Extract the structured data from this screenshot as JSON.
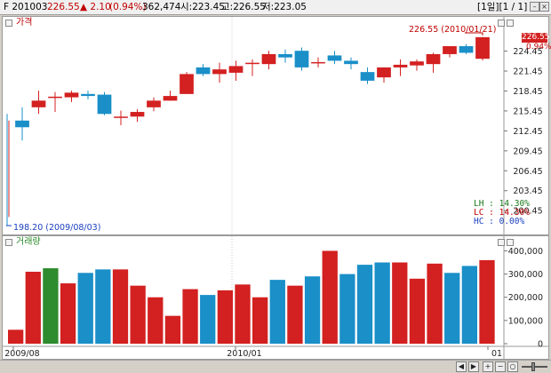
{
  "header": {
    "code": "F 201003",
    "price": "226.55",
    "change": "▲ 2.10",
    "change_pct": "(0.94%)",
    "volume": "362,474",
    "open": "시:223.45",
    "high": "고:226.55",
    "low": "저:223.05",
    "nav": "[1일][1 / 1]"
  },
  "price_pane": {
    "title": "가격",
    "last_price_label": "226.55",
    "last_change_label": "0.94%",
    "high_annotation": "226.55 (2010/01/21)",
    "low_annotation": "198.20 (2009/08/03)",
    "stats": {
      "lh": "LH : 14.30%",
      "lc": "LC : 14.30%",
      "hc": "HC :  0.00%"
    }
  },
  "volume_pane": {
    "title": "거래량"
  },
  "colors": {
    "up": "#d32020",
    "down": "#1a8fc8",
    "volume_green": "#2e8b2e",
    "pane_title_price": "#c00000",
    "pane_title_volume": "#2e8b2e",
    "stat_lh": "#1a7a1a",
    "stat_lc": "#c00000",
    "stat_hc": "#1a3fc0"
  },
  "chart_data": [
    {
      "type": "candlestick",
      "title": "가격",
      "ylim": [
        197,
        228
      ],
      "yticks": [
        200.45,
        203.45,
        206.45,
        209.45,
        212.45,
        215.45,
        218.45,
        221.45,
        224.45
      ],
      "xticks": [
        "2009/08",
        "2010/01",
        "01"
      ],
      "candles": [
        {
          "open": 214.0,
          "high": 216.0,
          "low": 211.0,
          "close": 213.0
        },
        {
          "open": 216.0,
          "high": 218.5,
          "low": 215.0,
          "close": 217.0
        },
        {
          "open": 217.6,
          "high": 218.3,
          "low": 215.3,
          "close": 217.6
        },
        {
          "open": 217.5,
          "high": 218.5,
          "low": 216.8,
          "close": 218.2
        },
        {
          "open": 218.0,
          "high": 218.5,
          "low": 217.2,
          "close": 217.7
        },
        {
          "open": 217.9,
          "high": 218.3,
          "low": 214.8,
          "close": 215.0
        },
        {
          "open": 214.6,
          "high": 215.5,
          "low": 213.3,
          "close": 214.6
        },
        {
          "open": 214.6,
          "high": 215.7,
          "low": 213.8,
          "close": 215.3
        },
        {
          "open": 216.0,
          "high": 217.5,
          "low": 215.4,
          "close": 217.0
        },
        {
          "open": 217.0,
          "high": 218.5,
          "low": 217.0,
          "close": 217.7
        },
        {
          "open": 218.0,
          "high": 221.3,
          "low": 218.0,
          "close": 221.0
        },
        {
          "open": 222.0,
          "high": 222.5,
          "low": 220.7,
          "close": 221.0
        },
        {
          "open": 221.0,
          "high": 222.7,
          "low": 219.7,
          "close": 221.7
        },
        {
          "open": 221.2,
          "high": 223.0,
          "low": 220.0,
          "close": 222.2
        },
        {
          "open": 222.7,
          "high": 223.2,
          "low": 220.7,
          "close": 222.7
        },
        {
          "open": 222.5,
          "high": 224.5,
          "low": 221.7,
          "close": 224.0
        },
        {
          "open": 224.0,
          "high": 224.7,
          "low": 222.7,
          "close": 223.5
        },
        {
          "open": 224.5,
          "high": 225.0,
          "low": 221.5,
          "close": 222.0
        },
        {
          "open": 222.8,
          "high": 223.5,
          "low": 222.0,
          "close": 222.8
        },
        {
          "open": 223.8,
          "high": 224.5,
          "low": 222.5,
          "close": 223.0
        },
        {
          "open": 223.0,
          "high": 223.5,
          "low": 221.7,
          "close": 222.5
        },
        {
          "open": 221.3,
          "high": 222.0,
          "low": 219.5,
          "close": 220.0
        },
        {
          "open": 220.5,
          "high": 222.0,
          "low": 219.7,
          "close": 222.0
        },
        {
          "open": 222.0,
          "high": 223.2,
          "low": 220.7,
          "close": 222.4
        },
        {
          "open": 222.3,
          "high": 223.2,
          "low": 221.5,
          "close": 222.9
        },
        {
          "open": 222.5,
          "high": 224.2,
          "low": 221.2,
          "close": 224.0
        },
        {
          "open": 224.0,
          "high": 225.2,
          "low": 223.5,
          "close": 225.2
        },
        {
          "open": 225.2,
          "high": 225.5,
          "low": 224.0,
          "close": 224.2
        },
        {
          "open": 223.3,
          "high": 226.55,
          "low": 223.05,
          "close": 226.55
        }
      ]
    },
    {
      "type": "bar",
      "title": "거래량",
      "ylim": [
        0,
        440000
      ],
      "yticks": [
        0,
        100000,
        200000,
        300000,
        400000
      ],
      "values": [
        60000,
        310000,
        325000,
        260000,
        305000,
        320000,
        320000,
        250000,
        200000,
        120000,
        235000,
        210000,
        230000,
        255000,
        200000,
        275000,
        250000,
        290000,
        400000,
        300000,
        340000,
        350000,
        350000,
        280000,
        345000,
        305000,
        335000,
        360000
      ],
      "colors": [
        "up",
        "up",
        "green",
        "up",
        "down",
        "down",
        "up",
        "up",
        "up",
        "up",
        "up",
        "down",
        "up",
        "up",
        "up",
        "down",
        "up",
        "down",
        "up",
        "down",
        "down",
        "down",
        "up",
        "up",
        "up",
        "down",
        "down",
        "up"
      ]
    }
  ]
}
